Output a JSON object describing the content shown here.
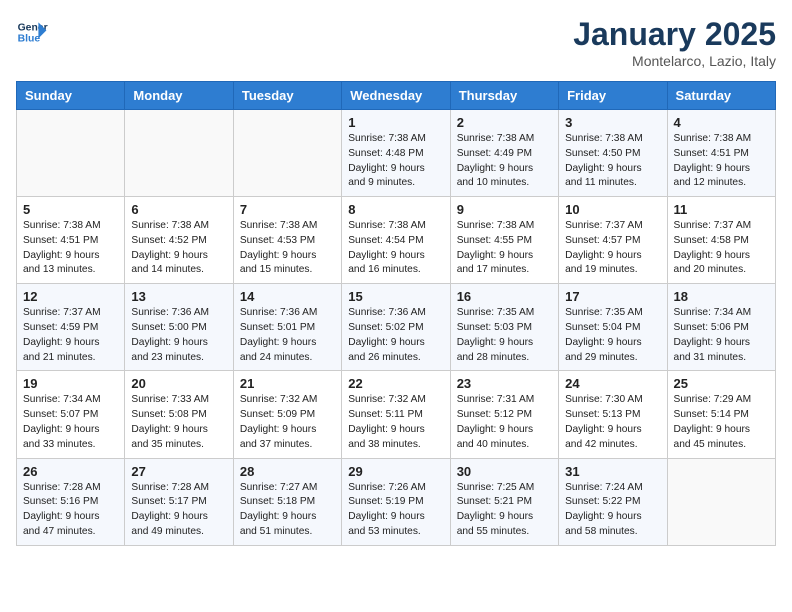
{
  "header": {
    "logo_line1": "General",
    "logo_line2": "Blue",
    "month": "January 2025",
    "location": "Montelarco, Lazio, Italy"
  },
  "weekdays": [
    "Sunday",
    "Monday",
    "Tuesday",
    "Wednesday",
    "Thursday",
    "Friday",
    "Saturday"
  ],
  "weeks": [
    [
      {
        "day": "",
        "info": ""
      },
      {
        "day": "",
        "info": ""
      },
      {
        "day": "",
        "info": ""
      },
      {
        "day": "1",
        "info": "Sunrise: 7:38 AM\nSunset: 4:48 PM\nDaylight: 9 hours\nand 9 minutes."
      },
      {
        "day": "2",
        "info": "Sunrise: 7:38 AM\nSunset: 4:49 PM\nDaylight: 9 hours\nand 10 minutes."
      },
      {
        "day": "3",
        "info": "Sunrise: 7:38 AM\nSunset: 4:50 PM\nDaylight: 9 hours\nand 11 minutes."
      },
      {
        "day": "4",
        "info": "Sunrise: 7:38 AM\nSunset: 4:51 PM\nDaylight: 9 hours\nand 12 minutes."
      }
    ],
    [
      {
        "day": "5",
        "info": "Sunrise: 7:38 AM\nSunset: 4:51 PM\nDaylight: 9 hours\nand 13 minutes."
      },
      {
        "day": "6",
        "info": "Sunrise: 7:38 AM\nSunset: 4:52 PM\nDaylight: 9 hours\nand 14 minutes."
      },
      {
        "day": "7",
        "info": "Sunrise: 7:38 AM\nSunset: 4:53 PM\nDaylight: 9 hours\nand 15 minutes."
      },
      {
        "day": "8",
        "info": "Sunrise: 7:38 AM\nSunset: 4:54 PM\nDaylight: 9 hours\nand 16 minutes."
      },
      {
        "day": "9",
        "info": "Sunrise: 7:38 AM\nSunset: 4:55 PM\nDaylight: 9 hours\nand 17 minutes."
      },
      {
        "day": "10",
        "info": "Sunrise: 7:37 AM\nSunset: 4:57 PM\nDaylight: 9 hours\nand 19 minutes."
      },
      {
        "day": "11",
        "info": "Sunrise: 7:37 AM\nSunset: 4:58 PM\nDaylight: 9 hours\nand 20 minutes."
      }
    ],
    [
      {
        "day": "12",
        "info": "Sunrise: 7:37 AM\nSunset: 4:59 PM\nDaylight: 9 hours\nand 21 minutes."
      },
      {
        "day": "13",
        "info": "Sunrise: 7:36 AM\nSunset: 5:00 PM\nDaylight: 9 hours\nand 23 minutes."
      },
      {
        "day": "14",
        "info": "Sunrise: 7:36 AM\nSunset: 5:01 PM\nDaylight: 9 hours\nand 24 minutes."
      },
      {
        "day": "15",
        "info": "Sunrise: 7:36 AM\nSunset: 5:02 PM\nDaylight: 9 hours\nand 26 minutes."
      },
      {
        "day": "16",
        "info": "Sunrise: 7:35 AM\nSunset: 5:03 PM\nDaylight: 9 hours\nand 28 minutes."
      },
      {
        "day": "17",
        "info": "Sunrise: 7:35 AM\nSunset: 5:04 PM\nDaylight: 9 hours\nand 29 minutes."
      },
      {
        "day": "18",
        "info": "Sunrise: 7:34 AM\nSunset: 5:06 PM\nDaylight: 9 hours\nand 31 minutes."
      }
    ],
    [
      {
        "day": "19",
        "info": "Sunrise: 7:34 AM\nSunset: 5:07 PM\nDaylight: 9 hours\nand 33 minutes."
      },
      {
        "day": "20",
        "info": "Sunrise: 7:33 AM\nSunset: 5:08 PM\nDaylight: 9 hours\nand 35 minutes."
      },
      {
        "day": "21",
        "info": "Sunrise: 7:32 AM\nSunset: 5:09 PM\nDaylight: 9 hours\nand 37 minutes."
      },
      {
        "day": "22",
        "info": "Sunrise: 7:32 AM\nSunset: 5:11 PM\nDaylight: 9 hours\nand 38 minutes."
      },
      {
        "day": "23",
        "info": "Sunrise: 7:31 AM\nSunset: 5:12 PM\nDaylight: 9 hours\nand 40 minutes."
      },
      {
        "day": "24",
        "info": "Sunrise: 7:30 AM\nSunset: 5:13 PM\nDaylight: 9 hours\nand 42 minutes."
      },
      {
        "day": "25",
        "info": "Sunrise: 7:29 AM\nSunset: 5:14 PM\nDaylight: 9 hours\nand 45 minutes."
      }
    ],
    [
      {
        "day": "26",
        "info": "Sunrise: 7:28 AM\nSunset: 5:16 PM\nDaylight: 9 hours\nand 47 minutes."
      },
      {
        "day": "27",
        "info": "Sunrise: 7:28 AM\nSunset: 5:17 PM\nDaylight: 9 hours\nand 49 minutes."
      },
      {
        "day": "28",
        "info": "Sunrise: 7:27 AM\nSunset: 5:18 PM\nDaylight: 9 hours\nand 51 minutes."
      },
      {
        "day": "29",
        "info": "Sunrise: 7:26 AM\nSunset: 5:19 PM\nDaylight: 9 hours\nand 53 minutes."
      },
      {
        "day": "30",
        "info": "Sunrise: 7:25 AM\nSunset: 5:21 PM\nDaylight: 9 hours\nand 55 minutes."
      },
      {
        "day": "31",
        "info": "Sunrise: 7:24 AM\nSunset: 5:22 PM\nDaylight: 9 hours\nand 58 minutes."
      },
      {
        "day": "",
        "info": ""
      }
    ]
  ]
}
